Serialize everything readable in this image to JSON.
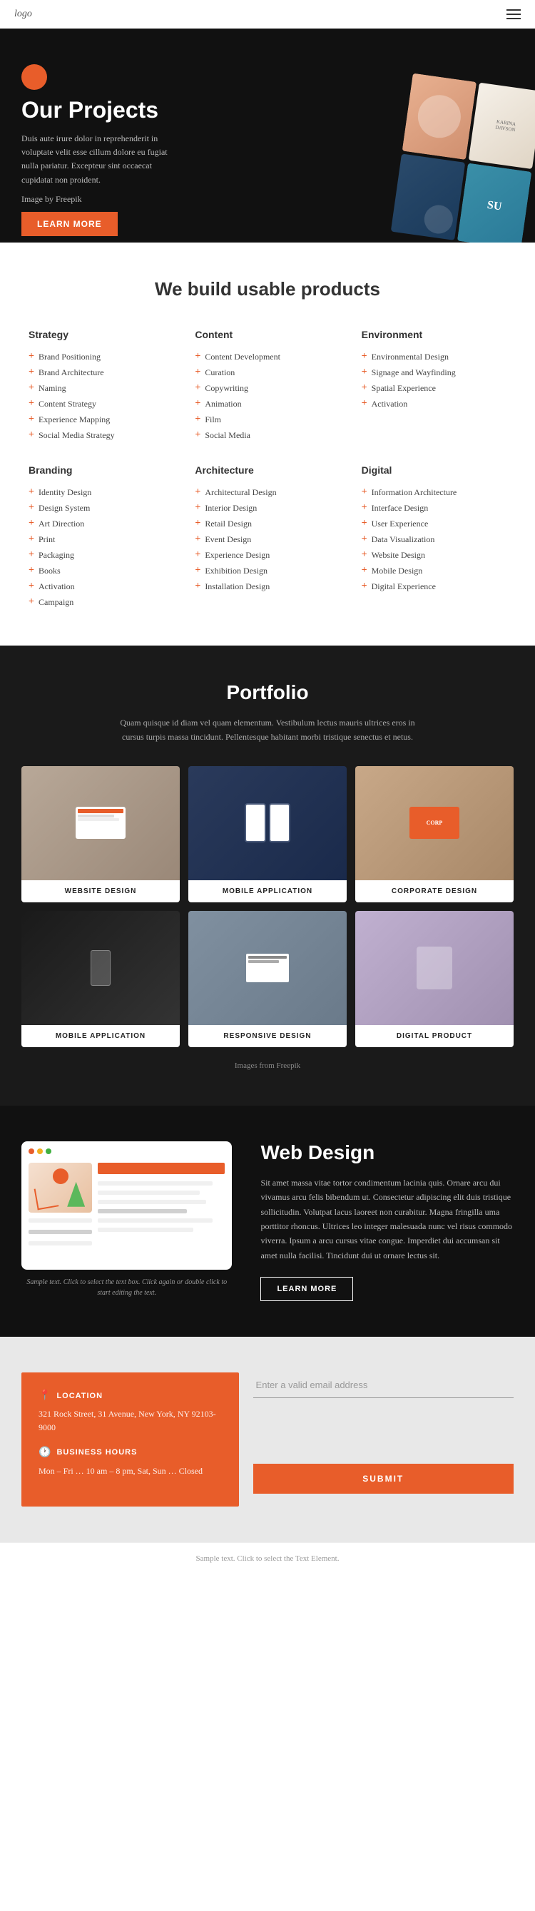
{
  "header": {
    "logo": "logo",
    "menu_icon": "☰"
  },
  "hero": {
    "title": "Our Projects",
    "description": "Duis aute irure dolor in reprehenderit in voluptate velit esse cillum dolore eu fugiat nulla pariatur. Excepteur sint occaecat cupidatat non proident.",
    "image_credit": "Image by Freepik",
    "learn_more_btn": "LEARN MORE"
  },
  "services": {
    "headline": "We build usable products",
    "columns": [
      {
        "heading": "Strategy",
        "items": [
          "Brand Positioning",
          "Brand Architecture",
          "Naming",
          "Content Strategy",
          "Experience Mapping",
          "Social Media Strategy"
        ]
      },
      {
        "heading": "Content",
        "items": [
          "Content Development",
          "Curation",
          "Copywriting",
          "Animation",
          "Film",
          "Social Media"
        ]
      },
      {
        "heading": "Environment",
        "items": [
          "Environmental Design",
          "Signage and Wayfinding",
          "Spatial Experience",
          "Activation"
        ]
      },
      {
        "heading": "Branding",
        "items": [
          "Identity Design",
          "Design System",
          "Art Direction",
          "Print",
          "Packaging",
          "Books",
          "Activation",
          "Campaign"
        ]
      },
      {
        "heading": "Architecture",
        "items": [
          "Architectural Design",
          "Interior Design",
          "Retail Design",
          "Event Design",
          "Experience Design",
          "Exhibition Design",
          "Installation Design"
        ]
      },
      {
        "heading": "Digital",
        "items": [
          "Information Architecture",
          "Interface Design",
          "User Experience",
          "Data Visualization",
          "Website Design",
          "Mobile Design",
          "Digital Experience"
        ]
      }
    ]
  },
  "portfolio": {
    "title": "Portfolio",
    "description": "Quam quisque id diam vel quam elementum. Vestibulum lectus mauris ultrices eros in cursus turpis massa tincidunt. Pellentesque habitant morbi tristique senectus et netus.",
    "items": [
      {
        "label": "WEBSITE DESIGN"
      },
      {
        "label": "MOBILE APPLICATION"
      },
      {
        "label": "CORPORATE DESIGN"
      },
      {
        "label": "MOBILE APPLICATION"
      },
      {
        "label": "RESPONSIVE DESIGN"
      },
      {
        "label": "DIGITAL PRODUCT"
      }
    ],
    "credits": "Images from Freepik"
  },
  "web_design": {
    "title": "Web Design",
    "description": "Sit amet massa vitae tortor condimentum lacinia quis. Ornare arcu dui vivamus arcu felis bibendum ut. Consectetur adipiscing elit duis tristique sollicitudin. Volutpat lacus laoreet non curabitur. Magna fringilla uma porttitor rhoncus. Ultrices leo integer malesuada nunc vel risus commodo viverra. Ipsum a arcu cursus vitae congue. Imperdiet dui accumsan sit amet nulla facilisi. Tincidunt dui ut ornare lectus sit.",
    "learn_more_btn": "LEARN MORE",
    "mockup_caption": "Sample text. Click to select the text box. Click again or double click to start editing the text."
  },
  "contact": {
    "location_label": "LOCATION",
    "location_text": "321 Rock Street, 31 Avenue, New York, NY 92103-9000",
    "hours_label": "BUSINESS HOURS",
    "hours_text": "Mon – Fri … 10 am – 8 pm, Sat, Sun … Closed",
    "email_placeholder": "Enter a valid email address",
    "submit_btn": "SUBMIT"
  },
  "footer": {
    "text": "Sample text. Click to select the Text Element."
  }
}
